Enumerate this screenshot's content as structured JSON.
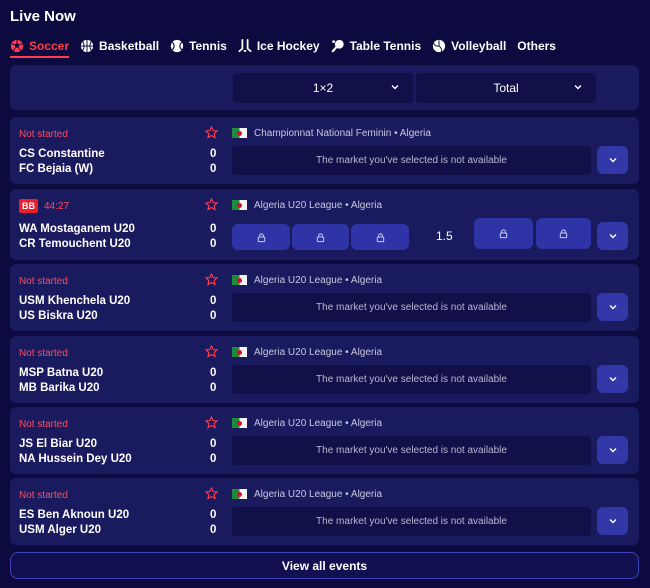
{
  "page": {
    "title": "Live Now"
  },
  "tabs": [
    {
      "label": "Soccer",
      "icon": "soccer-ball-icon",
      "active": true
    },
    {
      "label": "Basketball",
      "icon": "basketball-icon"
    },
    {
      "label": "Tennis",
      "icon": "tennis-ball-icon"
    },
    {
      "label": "Ice Hockey",
      "icon": "hockey-stick-icon"
    },
    {
      "label": "Table Tennis",
      "icon": "table-tennis-icon"
    },
    {
      "label": "Volleyball",
      "icon": "volleyball-icon"
    },
    {
      "label": "Others"
    }
  ],
  "markets": {
    "market1": "1×2",
    "market2": "Total"
  },
  "events": [
    {
      "status": "Not started",
      "league": "Championnat National Feminin • Algeria",
      "home": {
        "name": "CS Constantine",
        "score": "0"
      },
      "away": {
        "name": "FC Bejaia (W)",
        "score": "0"
      },
      "market_msg": "The market you've selected is not available"
    },
    {
      "live_badge": "BB",
      "live_time": "44:27",
      "league": "Algeria U20 League • Algeria",
      "home": {
        "name": "WA Mostaganem U20",
        "score": "0"
      },
      "away": {
        "name": "CR Temouchent U20",
        "score": "0"
      },
      "total_line": "1.5"
    },
    {
      "status": "Not started",
      "league": "Algeria U20 League • Algeria",
      "home": {
        "name": "USM Khenchela U20",
        "score": "0"
      },
      "away": {
        "name": "US Biskra U20",
        "score": "0"
      },
      "market_msg": "The market you've selected is not available"
    },
    {
      "status": "Not started",
      "league": "Algeria U20 League • Algeria",
      "home": {
        "name": "MSP Batna U20",
        "score": "0"
      },
      "away": {
        "name": "MB Barika U20",
        "score": "0"
      },
      "market_msg": "The market you've selected is not available"
    },
    {
      "status": "Not started",
      "league": "Algeria U20 League • Algeria",
      "home": {
        "name": "JS El Biar U20",
        "score": "0"
      },
      "away": {
        "name": "NA Hussein Dey U20",
        "score": "0"
      },
      "market_msg": "The market you've selected is not available"
    },
    {
      "status": "Not started",
      "league": "Algeria U20 League • Algeria",
      "home": {
        "name": "ES Ben Aknoun U20",
        "score": "0"
      },
      "away": {
        "name": "USM Alger U20",
        "score": "0"
      },
      "market_msg": "The market you've selected is not available"
    }
  ],
  "footer": {
    "view_all": "View all events"
  },
  "colors": {
    "background": "#0c0a3e",
    "card": "#1a1a5e",
    "accent": "#ff3b4e",
    "button": "#3238a8"
  }
}
